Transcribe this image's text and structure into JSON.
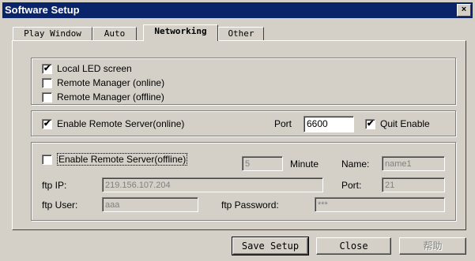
{
  "window": {
    "title": "Software Setup",
    "close_glyph": "×"
  },
  "tabs": [
    {
      "label": "Play Window",
      "active": false
    },
    {
      "label": "Auto",
      "active": false
    },
    {
      "label": "Networking",
      "active": true
    },
    {
      "label": "Other",
      "active": false
    }
  ],
  "display_group": {
    "local_led": {
      "label": "Local LED screen",
      "checked": true
    },
    "remote_online": {
      "label": "Remote Manager (online)",
      "checked": false
    },
    "remote_offline": {
      "label": "Remote Manager (offline)",
      "checked": false
    }
  },
  "online_server": {
    "enable": {
      "label": "Enable Remote Server(online)",
      "checked": true
    },
    "port_label": "Port",
    "port_value": "6600",
    "quit": {
      "label": "Quit Enable",
      "checked": true
    }
  },
  "offline_server": {
    "enable": {
      "label": "Enable Remote Server(offline)",
      "checked": false
    },
    "minute_value": "5",
    "minute_label": "Minute",
    "name_label": "Name:",
    "name_value": "name1",
    "ftp_ip_label": "ftp IP:",
    "ftp_ip_value": "219.156.107.204",
    "port_label": "Port:",
    "port_value": "21",
    "ftp_user_label": "ftp User:",
    "ftp_user_value": "aaa",
    "ftp_password_label": "ftp Password:",
    "ftp_password_value": "***"
  },
  "buttons": {
    "save": "Save Setup",
    "close": "Close",
    "help": "帮助"
  },
  "check_glyph": "✔"
}
